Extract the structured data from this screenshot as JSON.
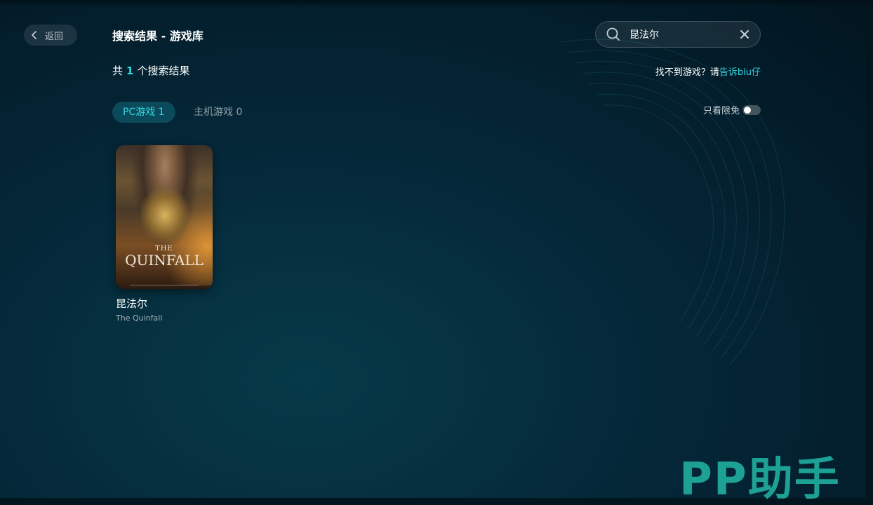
{
  "header": {
    "back_label": "返回",
    "title": "搜索结果 - 游戏库"
  },
  "search": {
    "value": "昆法尔"
  },
  "results": {
    "prefix": "共",
    "count": "1",
    "suffix": "个搜索结果"
  },
  "feedback": {
    "text": "找不到游戏？请",
    "link": "告诉biu仔"
  },
  "tabs": [
    {
      "label": "PC游戏 1",
      "active": true
    },
    {
      "label": "主机游戏 0",
      "active": false
    }
  ],
  "filter": {
    "label": "只看限免",
    "enabled": false
  },
  "games": [
    {
      "title": "昆法尔",
      "subtitle": "The Quinfall",
      "cover_small": "THE",
      "cover_name": "QUINFALL"
    }
  ],
  "watermark": "PP助手",
  "colors": {
    "accent": "#2fd3e0",
    "watermark": "#1fa89a"
  }
}
